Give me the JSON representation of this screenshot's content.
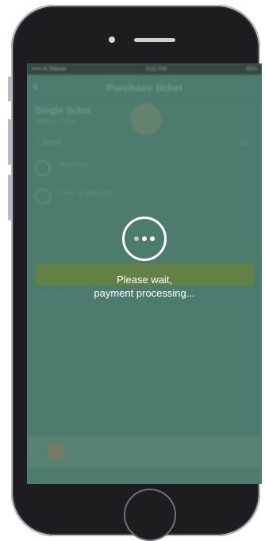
{
  "status_bar": {
    "carrier": "••••• N Telenor",
    "time": "5:22 PM",
    "battery": "93%"
  },
  "navbar": {
    "title": "Purchase ticket",
    "back_icon": "chevron-left-icon"
  },
  "ticket": {
    "title": "Single ticket",
    "subtitle": "Valid in Zone 1",
    "adult_label": "1 adult",
    "adult_price": "33,-"
  },
  "rows": [
    {
      "title": "Start time",
      "detail": "Today, 5:22 PM for 1 h"
    },
    {
      "title": "Form of payment",
      "detail": "Visa"
    }
  ],
  "terms_text": "Ruter's Ticket Terms",
  "loading": {
    "line1": "Please wait,",
    "line2": "payment processing..."
  },
  "colors": {
    "overlay": "#4f7c6f",
    "accent_bar": "#69843c",
    "spinner": "#ffffff"
  }
}
